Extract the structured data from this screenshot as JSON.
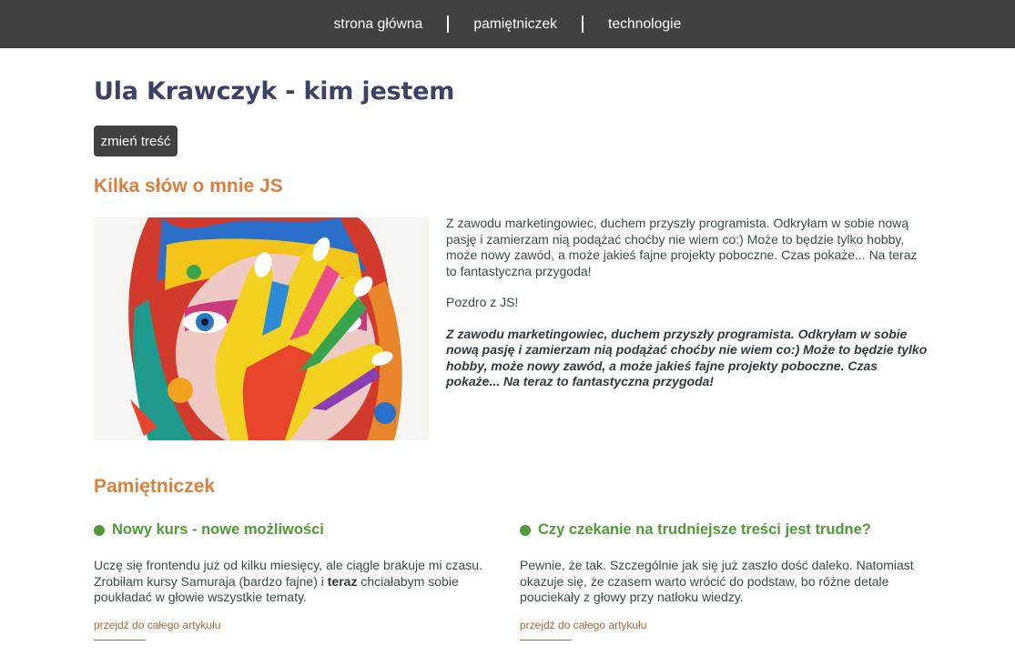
{
  "nav": {
    "items": [
      {
        "label": "strona główna"
      },
      {
        "label": "pamiętniczek"
      },
      {
        "label": "technologie"
      }
    ]
  },
  "header": {
    "title": "Ula Krawczyk - kim jestem",
    "change_button": "zmień treść"
  },
  "about": {
    "heading": "Kilka słów o mnie JS",
    "paragraph1": "Z zawodu marketingowiec, duchem przyszły programista. Odkryłam w sobie nową pasję i zamierzam nią podążać choćby nie wiem co:) Może to będzie tylko hobby, może nowy zawód, a może jakieś fajne projekty poboczne. Czas pokaże... Na teraz to fantastyczna przygoda!",
    "paragraph2": "Pozdro z JS!",
    "paragraph3": "Z zawodu marketingowiec, duchem przyszły programista. Odkryłam w sobie nową pasję i zamierzam nią podążać choćby nie wiem co:) Może to będzie tylko hobby, może nowy zawód, a może jakieś fajne projekty poboczne. Czas pokaże... Na teraz to fantastyczna przygoda!"
  },
  "diary": {
    "heading": "Pamiętniczek",
    "articles": [
      {
        "title": "Nowy kurs - nowe możliwości",
        "body_before": "Uczę się frontendu już od kilku miesięcy, ale ciągle brakuje mi czasu. Zrobiłam kursy Samuraja (bardzo fajne) i ",
        "body_bold": "teraz",
        "body_after": " chciałabym sobie poukładać w głowie wszystkie tematy.",
        "link": "przejdź do całego artykułu"
      },
      {
        "title": "Czy czekanie na trudniejsze treści jest trudne?",
        "body_before": "Pewnie, że tak. Szczególnie jak się już zaszło dość daleko. Natomiast okazuje się, że czasem warto wrócić do podstaw, bo różne detale pouciekały z głowy przy natłoku wiedzy.",
        "link": "przejdź do całego artykułu"
      }
    ]
  },
  "colors": {
    "nav_bg": "#414141",
    "title": "#3b4266",
    "section_heading": "#d9803c",
    "article_title": "#4f9a37",
    "link": "#a06a3a"
  }
}
